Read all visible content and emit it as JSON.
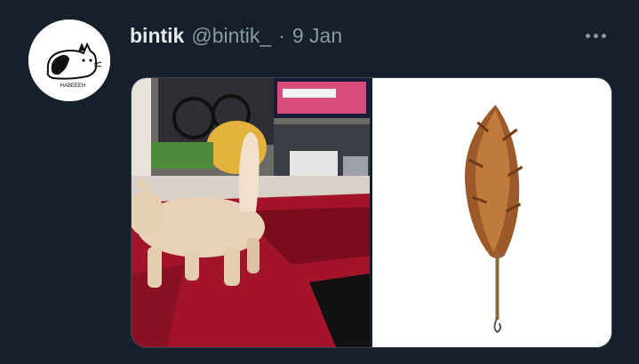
{
  "tweet": {
    "author_name": "bintik",
    "author_handle": "@bintik_",
    "separator": "·",
    "date": "9 Jan",
    "avatar_label": "HABEEEH"
  },
  "media": {
    "photo_left": "photo-cat-on-red-rug",
    "photo_right": "photo-feather-duster"
  },
  "icons": {
    "more": "more-horizontal-icon"
  },
  "colors": {
    "background": "#15202b",
    "name_text": "#e7e9ea",
    "secondary_text": "#8b98a5"
  }
}
